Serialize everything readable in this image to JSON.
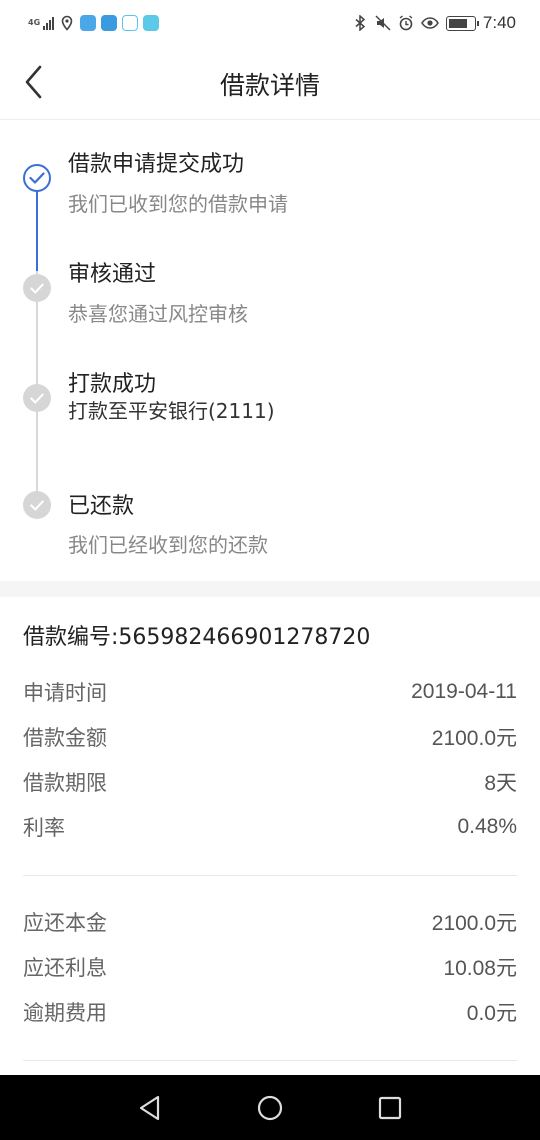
{
  "status_bar": {
    "network": "4G",
    "time": "7:40",
    "icons": [
      "signal-icon",
      "location-icon",
      "app-icon",
      "app-icon",
      "app-icon",
      "app-icon",
      "bluetooth-icon",
      "mute-icon",
      "alarm-icon",
      "eye-icon",
      "battery-icon"
    ]
  },
  "header": {
    "title": "借款详情",
    "back_icon": "chevron-left-icon"
  },
  "timeline": [
    {
      "title": "借款申请提交成功",
      "subtitle": "我们已收到您的借款申请",
      "state": "active"
    },
    {
      "title": "审核通过",
      "subtitle": "恭喜您通过风控审核",
      "state": "done"
    },
    {
      "title": "打款成功",
      "subtitle": "打款至平安银行(2111)",
      "state": "done"
    },
    {
      "title": "已还款",
      "subtitle": "我们已经收到您的还款",
      "state": "done"
    }
  ],
  "loan": {
    "number_text": "借款编号:565982466901278720",
    "info": [
      {
        "label": "申请时间",
        "value": "2019-04-11"
      },
      {
        "label": "借款金额",
        "value": "2100.0元"
      },
      {
        "label": "借款期限",
        "value": "8天"
      },
      {
        "label": "利率",
        "value": "0.48%"
      }
    ],
    "repay": [
      {
        "label": "应还本金",
        "value": "2100.0元"
      },
      {
        "label": "应还利息",
        "value": "10.08元"
      },
      {
        "label": "逾期费用",
        "value": "0.0元"
      }
    ]
  },
  "colors": {
    "accent": "#3a6fd8",
    "inactive_dot": "#d6d6d6",
    "nav_bar": "#000000"
  },
  "nav": [
    "back-triangle-icon",
    "home-circle-icon",
    "recent-square-icon"
  ]
}
